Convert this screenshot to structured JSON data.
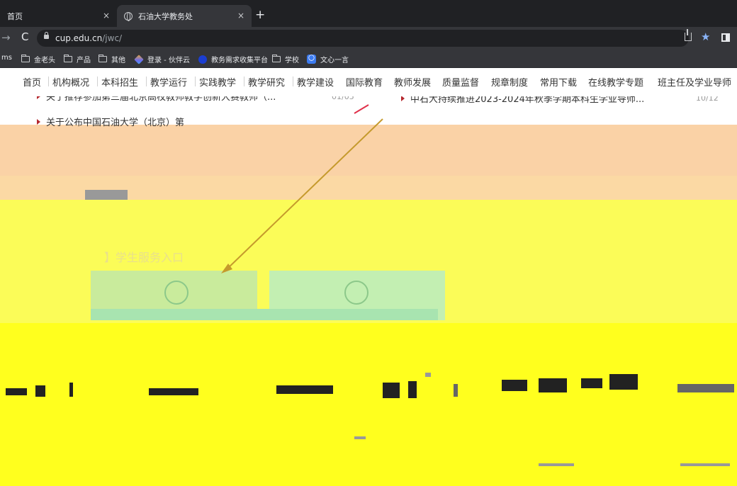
{
  "tabs": [
    {
      "label": "首页",
      "close": "×"
    },
    {
      "label": "石油大学教务处",
      "close": "×"
    }
  ],
  "new_tab": "+",
  "toolbar": {
    "back": "→",
    "reload": "C",
    "url_host": "cup.edu.cn",
    "url_path": "/jwc/",
    "star": "★"
  },
  "bookmarks": [
    {
      "label": "ms",
      "icon": "none"
    },
    {
      "label": "金老头",
      "icon": "folder-icon"
    },
    {
      "label": "产品",
      "icon": "folder-icon"
    },
    {
      "label": "其他",
      "icon": "folder-icon"
    },
    {
      "label": "登录 - 伙伴云",
      "icon": "huobanyun-icon"
    },
    {
      "label": "教务需求收集平台",
      "icon": "dot-icon"
    },
    {
      "label": "学校",
      "icon": "folder-icon"
    },
    {
      "label": "文心一言",
      "icon": "ai-icon"
    }
  ],
  "bookmark_ai_glyph": "〇",
  "nav": [
    "首页",
    "机构概况",
    "本科招生",
    "教学运行",
    "实践教学",
    "教学研究",
    "教学建设",
    "国际教育",
    "教师发展",
    "质量监督",
    "规章制度",
    "常用下载",
    "在线教学专题",
    "班主任及学业导师"
  ],
  "news": [
    {
      "title": "关于推荐参加第三届北京高校教师教学创新大赛教师（...",
      "date": "01/05"
    },
    {
      "title": "中石大持续推进2023-2024年秋季学期本科生学业导师...",
      "date": "10/12"
    },
    {
      "title": "关于公布中国石油大学（北京）第",
      "date": ""
    }
  ],
  "section_title": "】学生服务入口",
  "colors": {
    "chrome_dark": "#202124",
    "chrome_mid": "#35363a",
    "peach_band": "#fad2a6",
    "yellow_band": "#fbfc58",
    "bright_yellow": "#ffff1e",
    "accent_red": "#b5282e"
  }
}
